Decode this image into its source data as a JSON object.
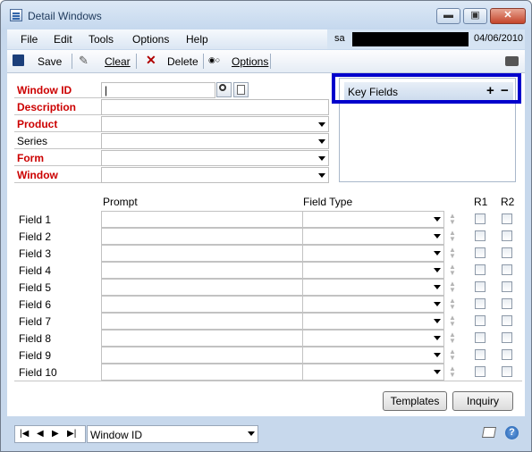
{
  "window": {
    "title": "Detail Windows"
  },
  "title_buttons": {
    "minimize": "▬",
    "maximize": "▣",
    "close": "✕"
  },
  "menu": [
    "File",
    "Edit",
    "Tools",
    "Options",
    "Help"
  ],
  "user": {
    "name": "sa",
    "date": "04/06/2010"
  },
  "toolbar": {
    "save": "Save",
    "clear": "Clear",
    "delete": "Delete",
    "options": "Options"
  },
  "header_fields": [
    {
      "label": "Window ID",
      "required": true,
      "value": "|"
    },
    {
      "label": "Description",
      "required": true,
      "value": ""
    },
    {
      "label": "Product",
      "required": true,
      "value": ""
    },
    {
      "label": "Series",
      "required": false,
      "value": ""
    },
    {
      "label": "Form",
      "required": true,
      "value": ""
    },
    {
      "label": "Window",
      "required": true,
      "value": ""
    }
  ],
  "key_fields": {
    "title": "Key Fields",
    "add": "+",
    "remove": "−"
  },
  "grid": {
    "headers": {
      "prompt": "Prompt",
      "field_type": "Field Type",
      "r1": "R1",
      "r2": "R2"
    },
    "rows": [
      "Field 1",
      "Field 2",
      "Field 3",
      "Field 4",
      "Field 5",
      "Field 6",
      "Field 7",
      "Field 8",
      "Field 9",
      "Field 10"
    ]
  },
  "buttons": {
    "templates": "Templates",
    "inquiry": "Inquiry"
  },
  "status": {
    "sort_by": "Window ID",
    "help": "?"
  },
  "colors": {
    "required_label": "#cc0000",
    "highlight_border": "#0000cc",
    "chrome": "#c7d8ec"
  }
}
